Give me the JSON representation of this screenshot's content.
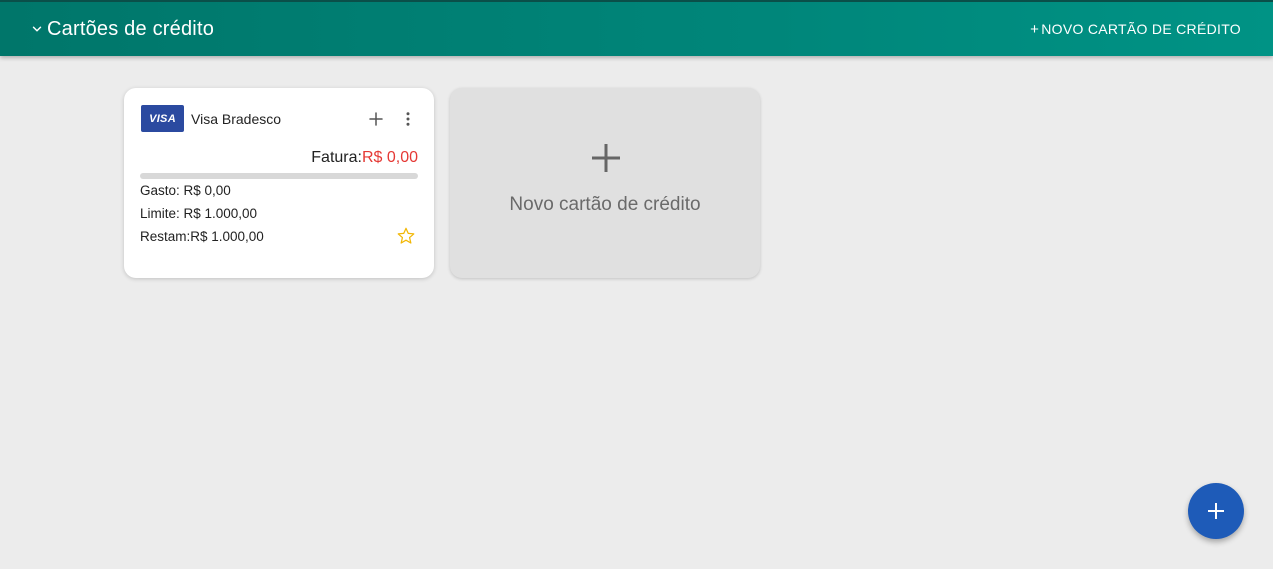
{
  "header": {
    "title": "Cartões de crédito",
    "new_card_label": "NOVO CARTÃO DE CRÉDITO",
    "new_card_plus": "+"
  },
  "cards": [
    {
      "brand_logo_text": "VISA",
      "name": "Visa Bradesco",
      "fatura_label": "Fatura:",
      "fatura_value": "R$ 0,00",
      "usage_fraction": 0,
      "gasto": "Gasto: R$ 0,00",
      "limite": "Limite: R$ 1.000,00",
      "restam": "Restam:R$ 1.000,00",
      "favorite": false,
      "icons": [
        "plus-icon",
        "more-vert-icon",
        "star-outline-icon"
      ]
    }
  ],
  "add_tile": {
    "label": "Novo cartão de crédito",
    "icon": "plus-icon"
  },
  "fab": {
    "icon": "plus-icon"
  },
  "colors": {
    "header": "#00867a",
    "fatura_value": "#e53935",
    "visa_logo": "#2b4aa0",
    "star": "#f2b705",
    "fab": "#1e5bb8",
    "background": "#ececec"
  }
}
